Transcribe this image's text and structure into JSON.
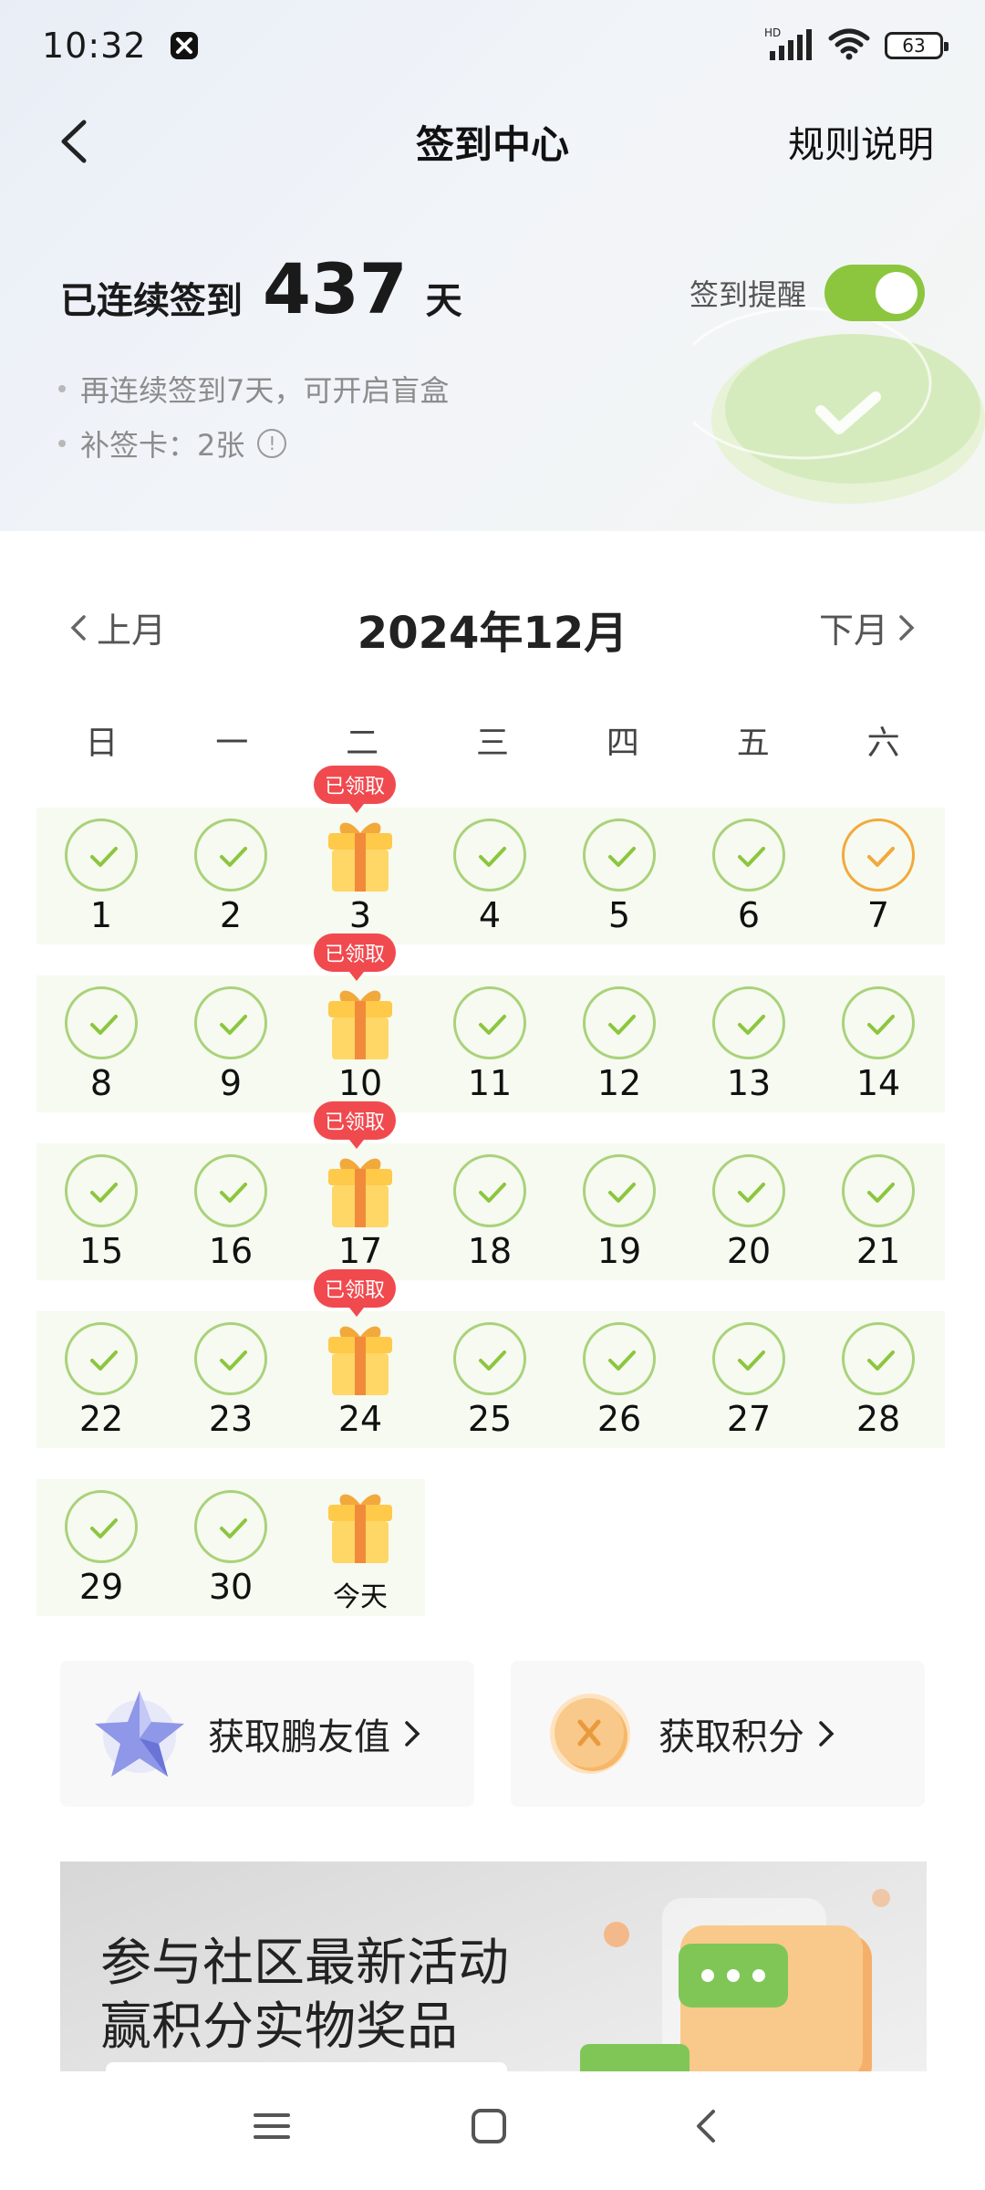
{
  "status_bar": {
    "time": "10:32",
    "network_label": "HD",
    "battery": "63"
  },
  "header": {
    "title": "签到中心",
    "rules_link": "规则说明"
  },
  "streak": {
    "prefix": "已连续签到",
    "days": "437",
    "unit": "天"
  },
  "reminder": {
    "label": "签到提醒",
    "enabled": true
  },
  "hints": [
    "再连续签到7天，可开启盲盒",
    "补签卡：2张"
  ],
  "calendar": {
    "prev_label": "上月",
    "next_label": "下月",
    "month_title": "2024年12月",
    "weekdays": [
      "日",
      "一",
      "二",
      "三",
      "四",
      "五",
      "六"
    ],
    "claimed_label": "已领取",
    "today_label": "今天",
    "days": [
      "1",
      "2",
      "3",
      "4",
      "5",
      "6",
      "7",
      "8",
      "9",
      "10",
      "11",
      "12",
      "13",
      "14",
      "15",
      "16",
      "17",
      "18",
      "19",
      "20",
      "21",
      "22",
      "23",
      "24",
      "25",
      "26",
      "27",
      "28",
      "29",
      "30"
    ]
  },
  "cards": {
    "friend_value": "获取鹏友值",
    "points": "获取积分"
  },
  "banner": {
    "line1": "参与社区最新活动",
    "line2": "赢积分实物奖品"
  },
  "colors": {
    "accent_green": "#8cc63f",
    "check_green": "#a9d27a",
    "today_orange": "#f2a93b",
    "claimed_red": "#f04a4f",
    "row_bg": "#f6faf0"
  }
}
